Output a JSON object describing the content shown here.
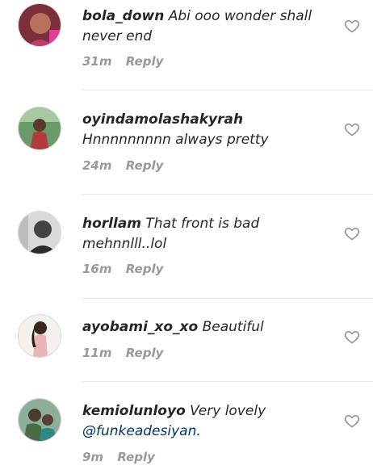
{
  "comments": [
    {
      "username": "bola_down",
      "text": "Abi ooo wonder shall never end",
      "time": "31m",
      "reply_label": "Reply"
    },
    {
      "username": "oyindamolashakyrah",
      "text": "Hnnnnnnnnn always pretty",
      "time": "24m",
      "reply_label": "Reply"
    },
    {
      "username": "horllam",
      "text": "That front is bad mehnnlll..lol",
      "time": "16m",
      "reply_label": "Reply"
    },
    {
      "username": "ayobami_xo_xo",
      "text": "Beautiful",
      "time": "11m",
      "reply_label": "Reply"
    },
    {
      "username": "kemiolunloyo",
      "text": "Very lovely",
      "mention": "@funkeadesiyan",
      "trailing": ".",
      "time": "9m",
      "reply_label": "Reply"
    }
  ],
  "colors": {
    "text": "#262626",
    "meta": "#999999",
    "mention": "#003569",
    "divider": "#e6e6e6"
  }
}
